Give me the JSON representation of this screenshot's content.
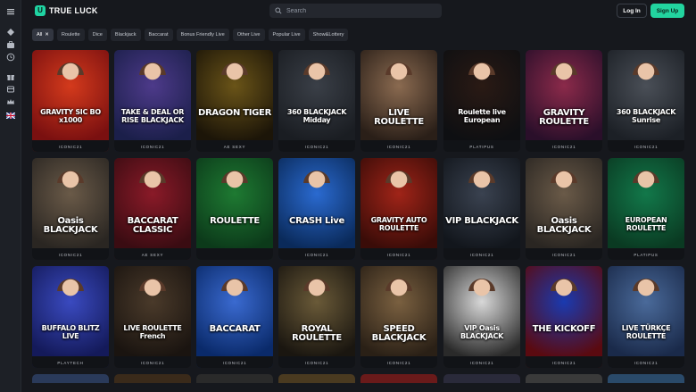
{
  "header": {
    "brand": "TRUE LUCK",
    "search_placeholder": "Search",
    "login_label": "Log In",
    "signup_label": "Sign Up"
  },
  "sidebar": {
    "icons": [
      "menu-icon",
      "diamond-icon",
      "briefcase-icon",
      "clock-icon",
      "gift-icon",
      "card-icon",
      "crown-icon",
      "uk-flag-icon"
    ]
  },
  "filters": [
    {
      "label": "All",
      "active": true,
      "closable": true
    },
    {
      "label": "Roulette"
    },
    {
      "label": "Dice"
    },
    {
      "label": "Blackjack"
    },
    {
      "label": "Baccarat"
    },
    {
      "label": "Bonus Friendly Live"
    },
    {
      "label": "Other Live"
    },
    {
      "label": "Popular Live"
    },
    {
      "label": "Show&Lottery"
    }
  ],
  "games": [
    {
      "title": "GRAVITY SIC BO x1000",
      "provider": "ICONIC21",
      "bg": [
        "#7a1010",
        "#d43a1c"
      ]
    },
    {
      "title": "TAKE & DEAL OR RISE BLACKJACK",
      "provider": "ICONIC21",
      "bg": [
        "#1b1f4a",
        "#4d3a8a"
      ]
    },
    {
      "title": "DRAGON TIGER",
      "provider": "AE SEXY",
      "bg": [
        "#1c1508",
        "#6a5418"
      ]
    },
    {
      "title": "360 BLACKJACK Midday",
      "provider": "ICONIC21",
      "bg": [
        "#1a1d22",
        "#3a3f47"
      ]
    },
    {
      "title": "LIVE ROULETTE",
      "provider": "ICONIC21",
      "bg": [
        "#2a1f18",
        "#8a6a50"
      ]
    },
    {
      "title": "Roulette live European",
      "provider": "PLATIPUS",
      "bg": [
        "#0e0f12",
        "#2a1a14"
      ]
    },
    {
      "title": "GRAVITY ROULETTE",
      "provider": "ICONIC21",
      "bg": [
        "#2a0f2a",
        "#8b2a4a"
      ]
    },
    {
      "title": "360 BLACKJACK Sunrise",
      "provider": "ICONIC21",
      "bg": [
        "#1c2026",
        "#4a4f57"
      ]
    },
    {
      "title": "Oasis BLACKJACK",
      "provider": "ICONIC21",
      "bg": [
        "#2a2622",
        "#6a5a48"
      ]
    },
    {
      "title": "BACCARAT CLASSIC",
      "provider": "AE SEXY",
      "bg": [
        "#3a0c12",
        "#8a1a28"
      ]
    },
    {
      "title": "ROULETTE",
      "provider": "",
      "bg": [
        "#0c3a1a",
        "#1e7a32"
      ]
    },
    {
      "title": "CRASH Live",
      "provider": "ICONIC21",
      "bg": [
        "#0a2a5a",
        "#2a6ad0"
      ]
    },
    {
      "title": "GRAVITY AUTO ROULETTE",
      "provider": "ICONIC21",
      "bg": [
        "#3a0c08",
        "#a02418"
      ]
    },
    {
      "title": "VIP BLACKJACK",
      "provider": "ICONIC21",
      "bg": [
        "#12161c",
        "#3a4250"
      ]
    },
    {
      "title": "Oasis BLACKJACK",
      "provider": "ICONIC21",
      "bg": [
        "#2a2622",
        "#6a5a48"
      ]
    },
    {
      "title": "EUROPEAN ROULETTE",
      "provider": "PLATIPUS",
      "bg": [
        "#0a3a22",
        "#12784a"
      ]
    },
    {
      "title": "BUFFALO BLITZ LIVE",
      "provider": "PLAYTECH",
      "bg": [
        "#141a5a",
        "#3a4ac0"
      ]
    },
    {
      "title": "LIVE ROULETTE French",
      "provider": "ICONIC21",
      "bg": [
        "#1a1410",
        "#4a3a2a"
      ]
    },
    {
      "title": "BACCARAT",
      "provider": "ICONIC21",
      "bg": [
        "#0a2a6a",
        "#3a6ad0"
      ]
    },
    {
      "title": "ROYAL ROULETTE",
      "provider": "ICONIC21",
      "bg": [
        "#1a1610",
        "#6a5a38"
      ]
    },
    {
      "title": "SPEED BLACKJACK",
      "provider": "ICONIC21",
      "bg": [
        "#2a2016",
        "#7a6040"
      ]
    },
    {
      "title": "VIP Oasis BLACKJACK",
      "provider": "ICONIC21",
      "bg": [
        "#2a2a2a",
        "#d8d8d8"
      ]
    },
    {
      "title": "THE KICKOFF",
      "provider": "ICONIC21",
      "bg": [
        "#5a0a10",
        "#1a3ab0"
      ]
    },
    {
      "title": "LIVE TÜRKÇE ROULETTE",
      "provider": "ICONIC21",
      "bg": [
        "#1a2a4a",
        "#4a6a9a"
      ]
    }
  ],
  "partial_row": [
    "#2a3a5a",
    "#3a2a1a",
    "#2a2a2a",
    "#4a3a20",
    "#6a1a1a",
    "#2a2a3a",
    "#3a3a3a",
    "#2a4a6a"
  ]
}
